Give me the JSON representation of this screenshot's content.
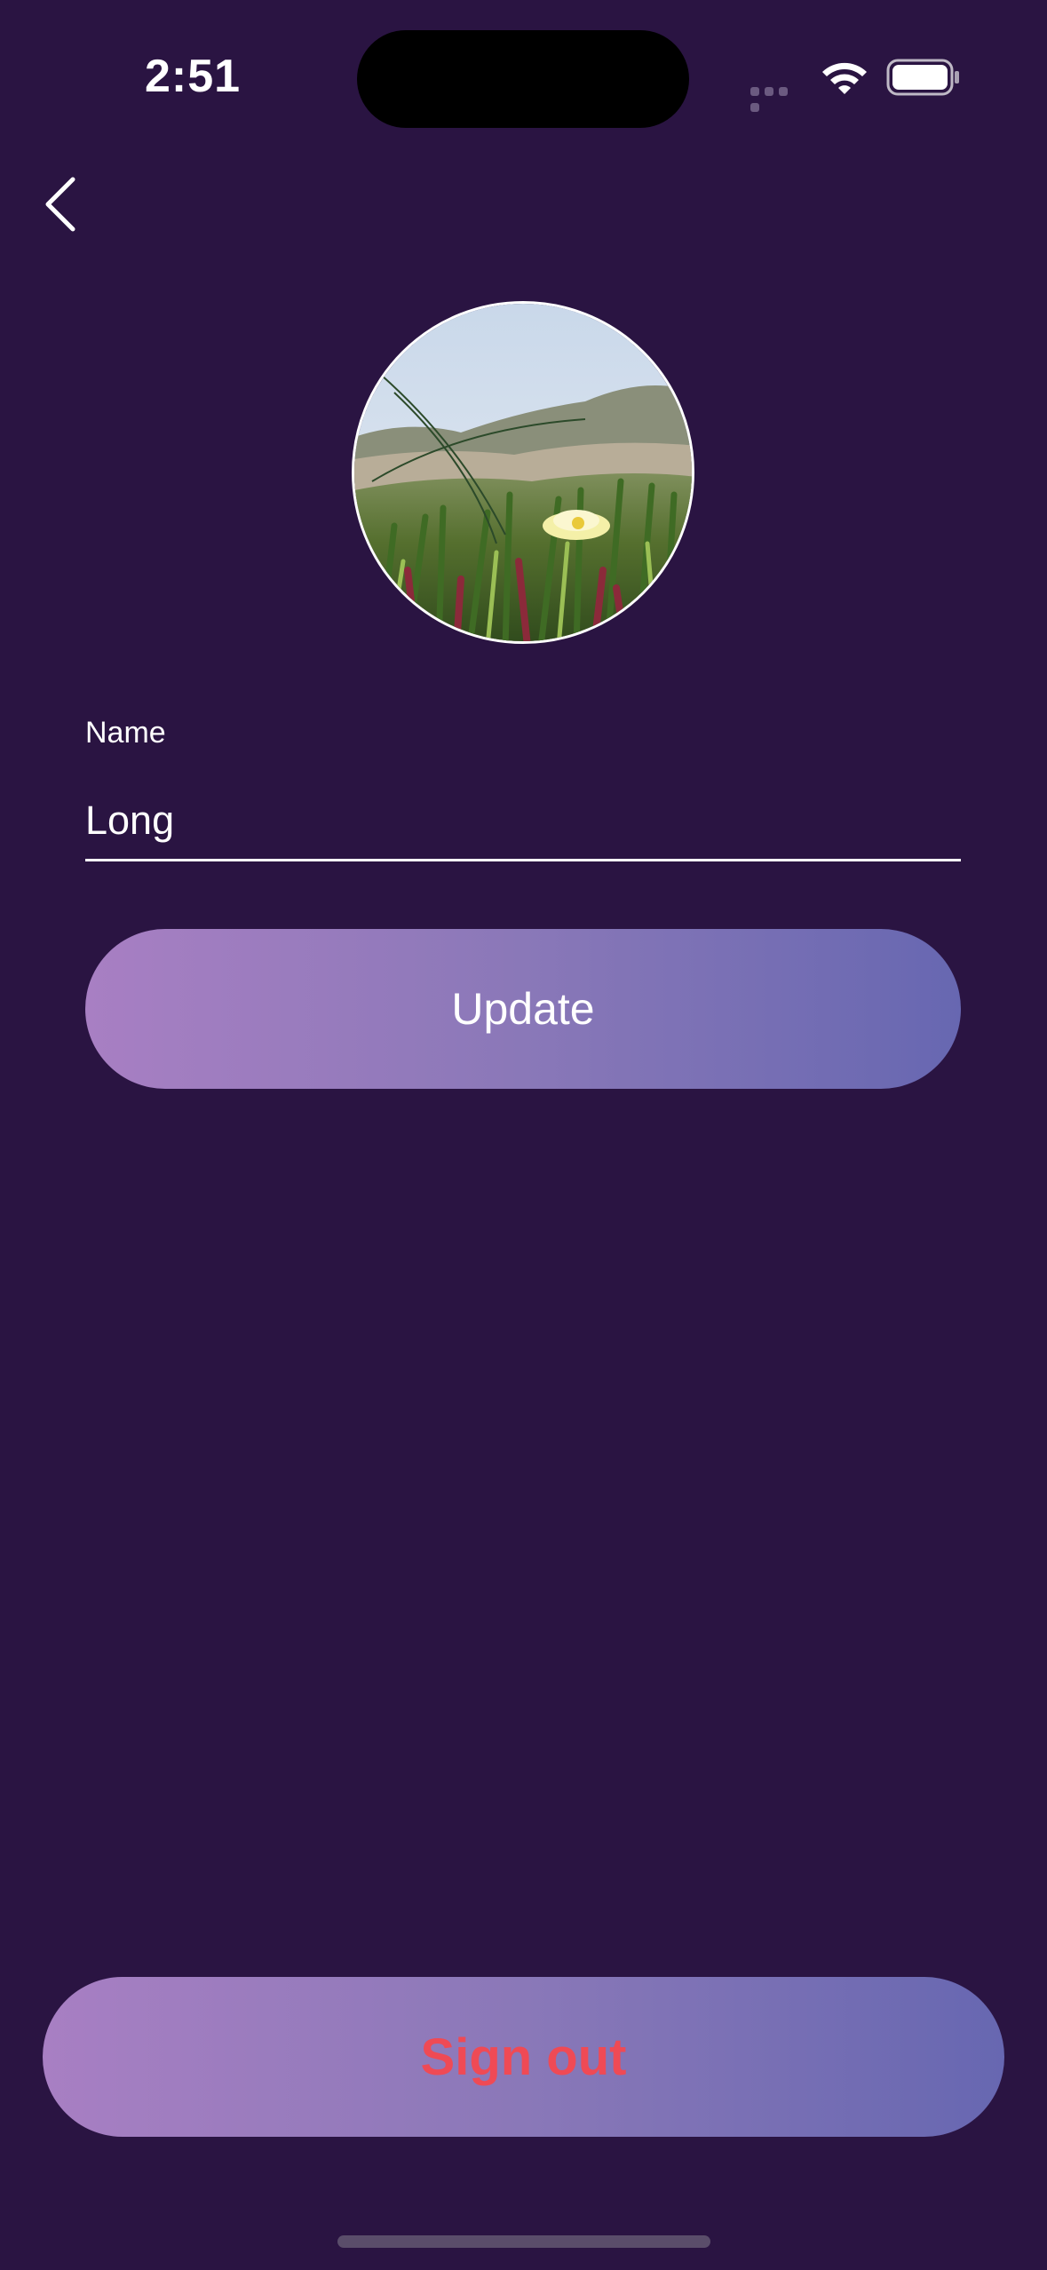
{
  "status_bar": {
    "time": "2:51",
    "icons": [
      "signal-dots-icon",
      "wifi-icon",
      "battery-icon"
    ]
  },
  "navigation": {
    "back_icon": "chevron-left-icon"
  },
  "profile": {
    "avatar_description": "profile-photo"
  },
  "form": {
    "name_label": "Name",
    "name_value": "Long"
  },
  "actions": {
    "update_label": "Update",
    "signout_label": "Sign out"
  },
  "colors": {
    "background": "#2a1442",
    "button_gradient_start": "#a87fc3",
    "button_gradient_end": "#6767b1",
    "signout_text": "#ef4a55"
  }
}
